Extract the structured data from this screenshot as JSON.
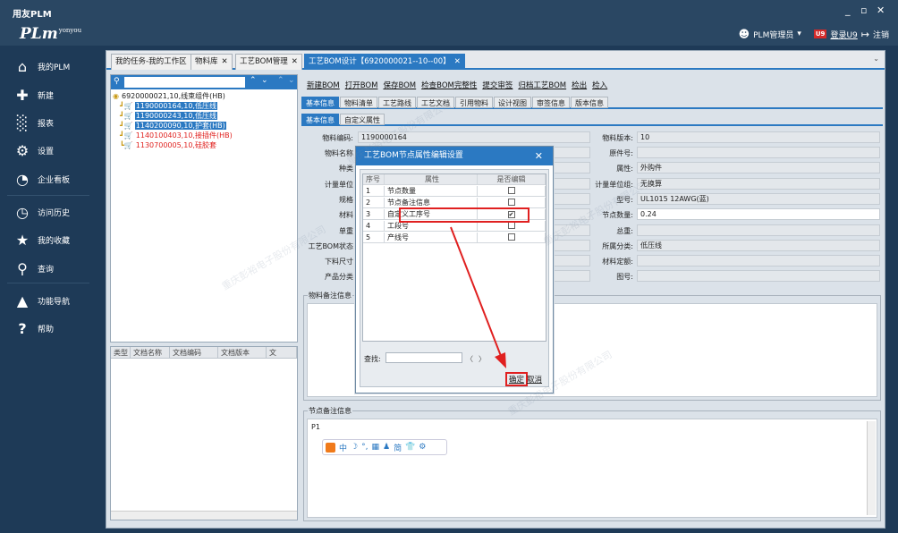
{
  "window": {
    "title": "用友PLM",
    "controls": [
      "_",
      "▫",
      "✕"
    ]
  },
  "header": {
    "logo": "PLm",
    "logo_sup": "yonyou",
    "user": "PLM管理员",
    "user_caret": "▾",
    "badge": "U9",
    "login": "登录U9",
    "logout": "注销"
  },
  "sidebar": {
    "items": [
      {
        "label": "我的PLM",
        "icon": "home-icon"
      },
      {
        "label": "新建",
        "icon": "plus-icon"
      },
      {
        "label": "报表",
        "icon": "bar-chart-icon"
      },
      {
        "label": "设置",
        "icon": "gear-icon"
      },
      {
        "label": "企业看板",
        "icon": "dashboard-icon"
      },
      {
        "label": "访问历史",
        "icon": "history-icon"
      },
      {
        "label": "我的收藏",
        "icon": "star-icon"
      },
      {
        "label": "查询",
        "icon": "search-icon"
      },
      {
        "label": "功能导航",
        "icon": "navigation-icon"
      },
      {
        "label": "帮助",
        "icon": "help-icon"
      }
    ]
  },
  "tabs": [
    {
      "label": "我的任务-我的工作区",
      "close": ""
    },
    {
      "label": "物料库",
      "close": "✕"
    },
    {
      "label": "工艺BOM管理",
      "close": "✕"
    },
    {
      "label": "工艺BOM设计【6920000021--10--00】",
      "close": "✕",
      "active": true
    }
  ],
  "tree": {
    "search_value": "",
    "nodes": [
      {
        "label": "6920000021,10,线束组件(HB)",
        "level": 0,
        "style": "root"
      },
      {
        "label": "1190000164,10,低压线",
        "level": 1,
        "style": "sel"
      },
      {
        "label": "1190000243,10,低压线",
        "level": 1,
        "style": "sel"
      },
      {
        "label": "1140200090,10,护套(HB)",
        "level": 1,
        "style": "sel"
      },
      {
        "label": "1140100403,10,接插件(HB)",
        "level": 1,
        "style": "red"
      },
      {
        "label": "1130700005,10,硅胶套",
        "level": 1,
        "style": "red"
      }
    ]
  },
  "doc_columns": [
    "类型",
    "文档名称",
    "文档编码",
    "文档版本",
    "文"
  ],
  "toolbar": [
    "新建BOM",
    "打开BOM",
    "保存BOM",
    "检查BOM完整性",
    "提交审签",
    "归档工艺BOM",
    "检出",
    "检入"
  ],
  "subtabs": [
    "基本信息",
    "物料清单",
    "工艺路线",
    "工艺文档",
    "引用物料",
    "设计视图",
    "审签信息",
    "版本信息"
  ],
  "subtabs2": [
    "基本信息",
    "自定义属性"
  ],
  "form": {
    "left": [
      {
        "label": "物料编码:",
        "value": "1190000164"
      },
      {
        "label": "物料名称",
        "value": ""
      },
      {
        "label": "种类",
        "value": ""
      },
      {
        "label": "计量单位",
        "value": ""
      },
      {
        "label": "规格",
        "value": ""
      },
      {
        "label": "材料",
        "value": ""
      },
      {
        "label": "单重",
        "value": ""
      },
      {
        "label": "工艺BOM状态",
        "value": ""
      },
      {
        "label": "下料尺寸",
        "value": ""
      },
      {
        "label": "产品分类",
        "value": ""
      }
    ],
    "right": [
      {
        "label": "物料版本:",
        "value": "10"
      },
      {
        "label": "原件号:",
        "value": ""
      },
      {
        "label": "属性:",
        "value": "外购件"
      },
      {
        "label": "计量单位组:",
        "value": "无换算"
      },
      {
        "label": "型号:",
        "value": "UL1015 12AWG(蓝)"
      },
      {
        "label": "节点数量:",
        "value": "0.24"
      },
      {
        "label": "总重:",
        "value": ""
      },
      {
        "label": "所属分类:",
        "value": "低压线"
      },
      {
        "label": "材料定额:",
        "value": ""
      },
      {
        "label": "图号:",
        "value": ""
      }
    ]
  },
  "material_note": {
    "title": "物料备注信息"
  },
  "node_note": {
    "title": "节点备注信息",
    "content": "P1"
  },
  "ime": [
    "中",
    "☽",
    "°,",
    "▦",
    "♟",
    "简",
    "👕",
    "⚙"
  ],
  "dialog": {
    "title": "工艺BOM节点属性编辑设置",
    "close": "✕",
    "columns": [
      "序号",
      "属性",
      "是否编辑"
    ],
    "rows": [
      {
        "no": "1",
        "attr": "节点数量",
        "edit": false
      },
      {
        "no": "2",
        "attr": "节点备注信息",
        "edit": false
      },
      {
        "no": "3",
        "attr": "自定义工序号",
        "edit": true
      },
      {
        "no": "4",
        "attr": "工段号",
        "edit": false
      },
      {
        "no": "5",
        "attr": "产线号",
        "edit": false
      }
    ],
    "search_label": "查找:",
    "search_value": "",
    "prev": "〈",
    "next": "〉",
    "ok": "确定",
    "cancel": "取消"
  },
  "watermark": "重庆彭裕电子股份有限公司"
}
